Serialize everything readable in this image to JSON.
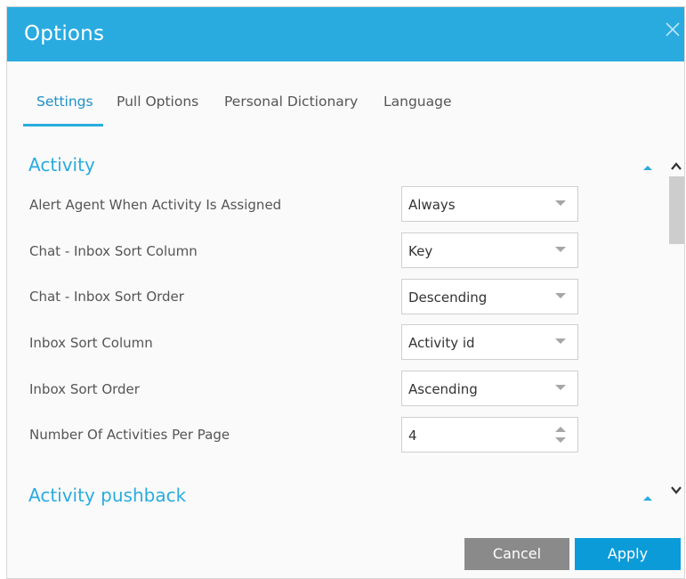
{
  "dialog": {
    "title": "Options"
  },
  "tabs": [
    {
      "label": "Settings",
      "active": true
    },
    {
      "label": "Pull Options",
      "active": false
    },
    {
      "label": "Personal Dictionary",
      "active": false
    },
    {
      "label": "Language",
      "active": false
    }
  ],
  "sections": [
    {
      "title": "Activity",
      "rows": [
        {
          "label": "Alert Agent When Activity Is Assigned",
          "value": "Always",
          "control": "select"
        },
        {
          "label": "Chat - Inbox Sort Column",
          "value": "Key",
          "control": "select"
        },
        {
          "label": "Chat - Inbox Sort Order",
          "value": "Descending",
          "control": "select"
        },
        {
          "label": "Inbox Sort Column",
          "value": "Activity id",
          "control": "select"
        },
        {
          "label": "Inbox Sort Order",
          "value": "Ascending",
          "control": "select"
        },
        {
          "label": "Number Of Activities Per Page",
          "value": "4",
          "control": "stepper"
        }
      ]
    },
    {
      "title": "Activity pushback"
    }
  ],
  "footer": {
    "cancel_label": "Cancel",
    "apply_label": "Apply"
  },
  "colors": {
    "accent": "#29abe0",
    "apply": "#0c9bd9",
    "cancel": "#8a8a8a"
  },
  "icons": [
    "close-icon",
    "collapse-arrow-icon",
    "scroll-up-icon",
    "scroll-down-icon",
    "dropdown-caret-icon",
    "stepper-up-icon",
    "stepper-down-icon"
  ]
}
